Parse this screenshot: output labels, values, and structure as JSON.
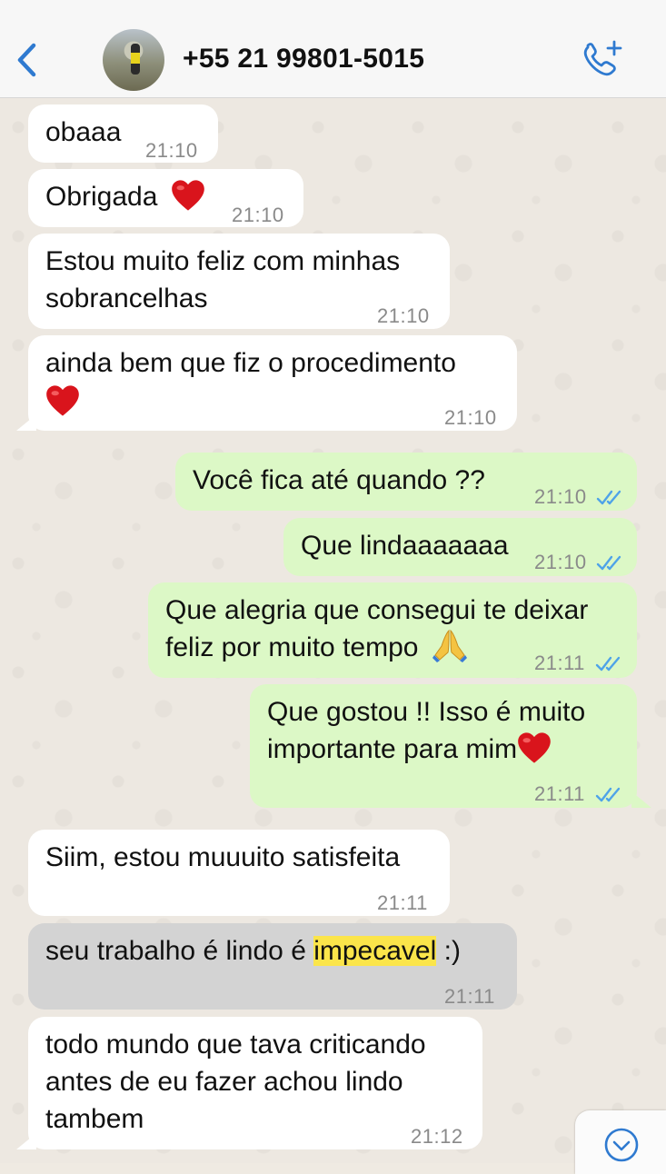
{
  "header": {
    "contact": "+55 21 99801-5015"
  },
  "messages": [
    {
      "text": "obaaa",
      "time": "21:10"
    },
    {
      "text": "Obrigada",
      "time": "21:10"
    },
    {
      "text1": "Estou muito feliz com minhas",
      "text2": "sobrancelhas",
      "time": "21:10"
    },
    {
      "text1": "ainda bem que fiz o procedimento",
      "time": "21:10"
    },
    {
      "text": "Você fica até quando ??",
      "time": "21:10"
    },
    {
      "text": "Que lindaaaaaaa",
      "time": "21:10"
    },
    {
      "text1": "Que alegria que consegui te deixar",
      "text2": "feliz por muito tempo",
      "time": "21:11"
    },
    {
      "text1": "Que gostou !! Isso é muito",
      "text2": "importante para mim",
      "time": "21:11"
    },
    {
      "text": "Siim, estou muuuito satisfeita",
      "time": "21:11"
    },
    {
      "pre": "seu trabalho é lindo é ",
      "highlight": "impecavel",
      "post": " :)",
      "time": "21:11"
    },
    {
      "text1": "todo mundo que tava criticando",
      "text2": "antes de eu fazer achou lindo",
      "text3": "tambem",
      "time": "21:12"
    }
  ],
  "icons": {
    "back": "chevron-left-icon",
    "call": "phone-plus-icon",
    "read": "double-check-icon",
    "scroll": "chevron-down-circle-icon"
  },
  "colors": {
    "incoming": "#ffffff",
    "outgoing": "#dcf8c6",
    "selected": "#d3d3d3",
    "highlight": "#fbe54a",
    "accent": "#2f7ad0"
  }
}
